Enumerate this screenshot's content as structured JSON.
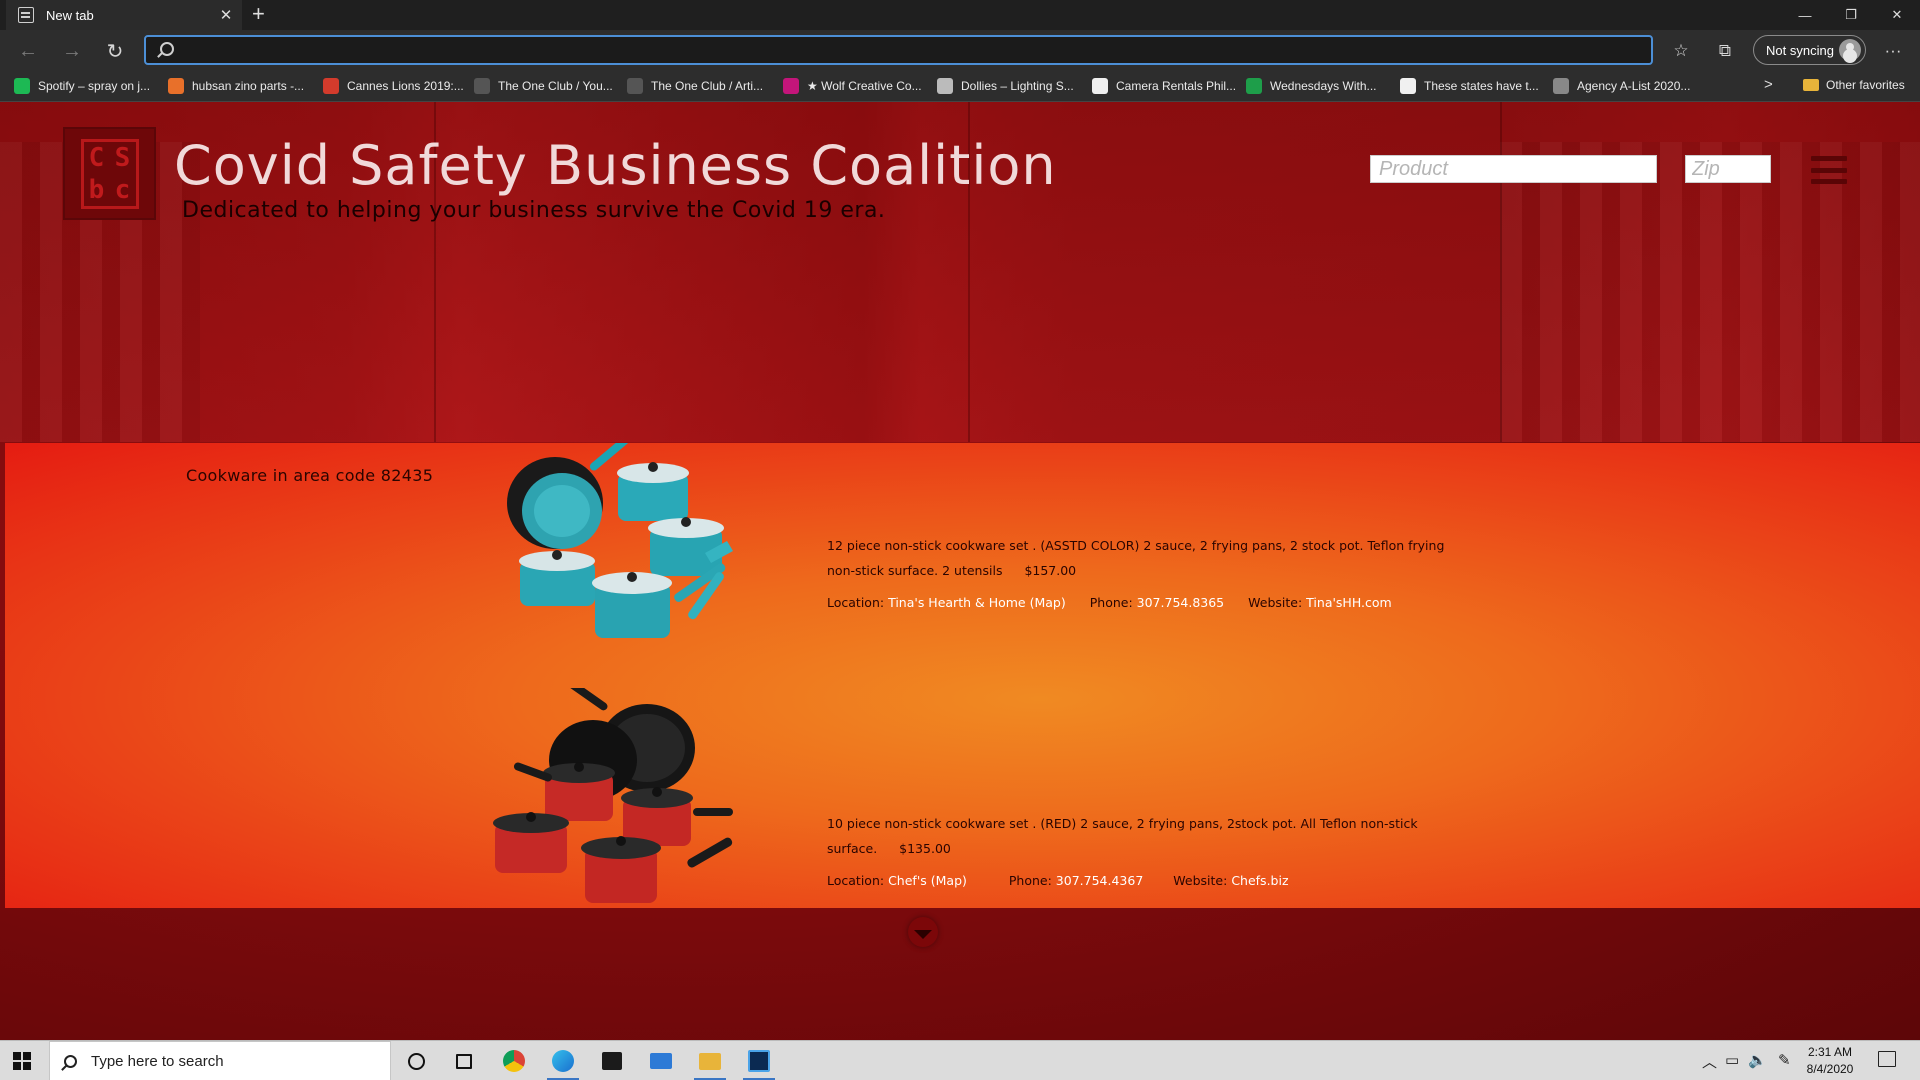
{
  "browser": {
    "tab_title": "New tab",
    "tab_close": "✕",
    "new_tab": "+",
    "window_controls": [
      "—",
      "❐",
      "✕"
    ],
    "address_value": "",
    "sync_label": "Not syncing",
    "favorites": [
      {
        "label": "Spotify – spray on j...",
        "icon": "spotify-icon",
        "color": "#1db954"
      },
      {
        "label": "hubsan zino parts -...",
        "icon": "bg-icon",
        "color": "#e8702a"
      },
      {
        "label": "Cannes Lions 2019:...",
        "icon": "cannes-icon",
        "color": "#d33b2c"
      },
      {
        "label": "The One Club / You...",
        "icon": "pencil-icon",
        "color": "#555555"
      },
      {
        "label": "The One Club / Arti...",
        "icon": "pencil-icon",
        "color": "#555555"
      },
      {
        "label": "★ Wolf Creative Co...",
        "icon": "wolf-icon",
        "color": "#c3157a"
      },
      {
        "label": "Dollies – Lighting S...",
        "icon": "page-icon",
        "color": "#bbbbbb"
      },
      {
        "label": "Camera Rentals Phil...",
        "icon": "camera-icon",
        "color": "#f0f0f0"
      },
      {
        "label": "Wednesdays With...",
        "icon": "sheets-icon",
        "color": "#1e9e4a"
      },
      {
        "label": "These states have t...",
        "icon": "news-icon",
        "color": "#f0f0f0"
      },
      {
        "label": "Agency A-List 2020...",
        "icon": "agency-icon",
        "color": "#888888"
      }
    ],
    "favorites_overflow": ">",
    "other_favorites": "Other favorites"
  },
  "site": {
    "logo_letters": [
      "C",
      "S",
      "b",
      "c"
    ],
    "title": "Covid Safety Business Coalition",
    "tagline": "Dedicated to helping your business survive the Covid 19 era.",
    "product_placeholder": "Product",
    "zip_placeholder": "Zip",
    "results_heading": "Cookware in area code 82435",
    "listings": [
      {
        "description": "12 piece non-stick cookware set . (ASSTD COLOR) 2 sauce, 2 frying pans, 2 stock pot. Teflon frying non-stick surface. 2 utensils",
        "price": "$157.00",
        "location_label": "Location:",
        "location_value": "Tina's Hearth & Home (Map)",
        "phone_label": "Phone:",
        "phone_value": "307.754.8365",
        "website_label": "Website:",
        "website_value": "Tina'sHH.com",
        "image_color": "turquoise"
      },
      {
        "description": "10 piece non-stick cookware set . (RED) 2 sauce, 2 frying pans, 2stock pot. All Teflon non-stick surface.",
        "price": "$135.00",
        "location_label": "Location:",
        "location_value": "Chef's (Map)",
        "phone_label": "Phone:",
        "phone_value": "307.754.4367",
        "website_label": "Website:",
        "website_value": "Chefs.biz",
        "image_color": "red"
      }
    ]
  },
  "taskbar": {
    "search_placeholder": "Type here to search",
    "time": "2:31 AM",
    "date": "8/4/2020"
  },
  "colors": {
    "accent_blue": "#4c8fd6",
    "hero_red": "#9f1012",
    "results_orange": "#f08a22",
    "results_red": "#e51c12"
  }
}
